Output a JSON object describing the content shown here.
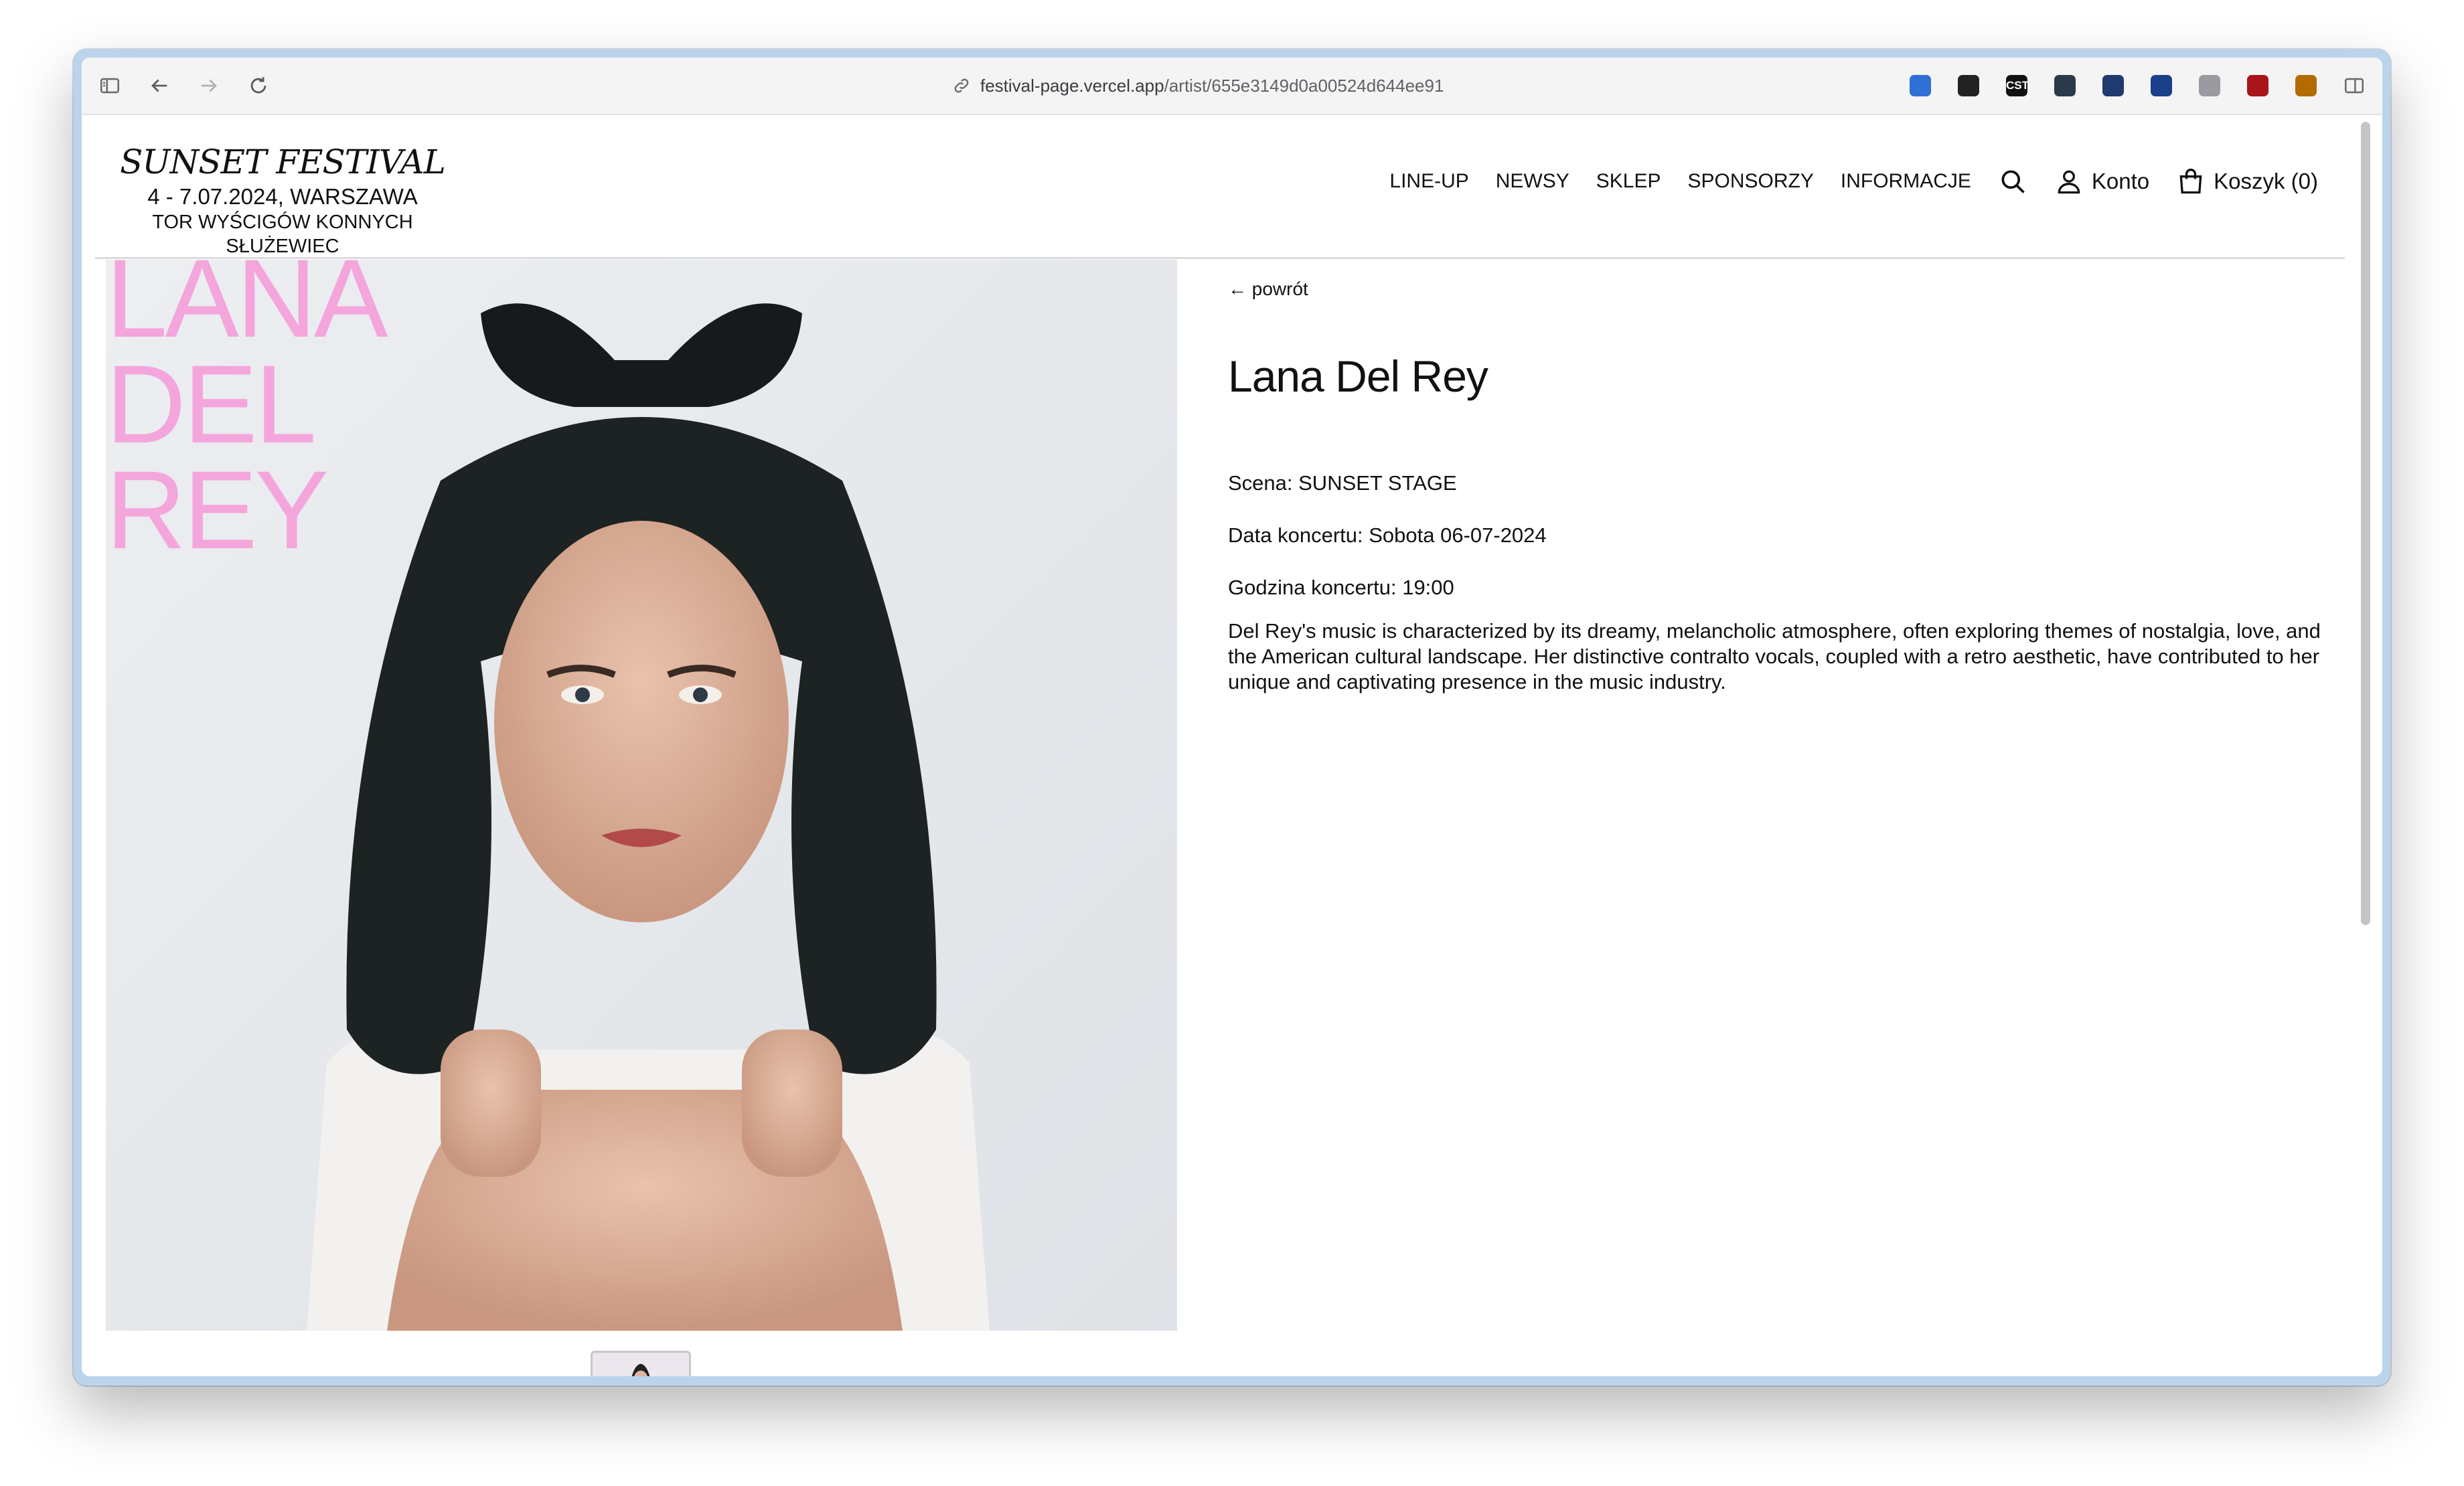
{
  "browser": {
    "url_host": "festival-page.vercel.app",
    "url_path": "/artist/655e3149d0a00524d644ee91",
    "extensions": [
      {
        "name": "1password-icon",
        "color": "#2f6fd6",
        "label": ""
      },
      {
        "name": "panda-icon",
        "color": "#222222",
        "label": ""
      },
      {
        "name": "cst-icon",
        "color": "#111111",
        "label": "CST"
      },
      {
        "name": "terminal-icon",
        "color": "#2a3a4a",
        "label": ""
      },
      {
        "name": "grid-icon",
        "color": "#1e3a6e",
        "label": ""
      },
      {
        "name": "hexagon-icon",
        "color": "#1c3f8a",
        "label": ""
      },
      {
        "name": "vuetify-icon",
        "color": "#9a9aa0",
        "label": ""
      },
      {
        "name": "ublock-icon",
        "color": "#a8151a",
        "label": ""
      },
      {
        "name": "list-icon",
        "color": "#b36b00",
        "label": ""
      }
    ]
  },
  "header": {
    "logo_title": "SUNSET FESTIVAL",
    "logo_date": "4 - 7.07.2024, WARSZAWA",
    "logo_venue": "TOR WYŚCIGÓW KONNYCH SŁUŻEWIEC",
    "nav": [
      "LINE-UP",
      "NEWSY",
      "SKLEP",
      "SPONSORZY",
      "INFORMACJE"
    ],
    "account_label": "Konto",
    "cart_label": "Koszyk (0)"
  },
  "artist": {
    "photo_overlay": [
      "LANA",
      "DEL",
      "REY"
    ],
    "back_label": "← powrót",
    "name": "Lana Del Rey",
    "stage": "Scena: SUNSET STAGE",
    "date": "Data koncertu: Sobota 06-07-2024",
    "time": "Godzina koncertu: 19:00",
    "bio": "Del Rey's music is characterized by its dreamy, melancholic atmosphere, often exploring themes of nostalgia, love, and the American cultural landscape. Her distinctive contralto vocals, coupled with a retro aesthetic, have contributed to her unique and captivating presence in the music industry."
  },
  "colors": {
    "overlay_pink": "#f4a6dc",
    "window_frame": "#bcd3ec"
  }
}
